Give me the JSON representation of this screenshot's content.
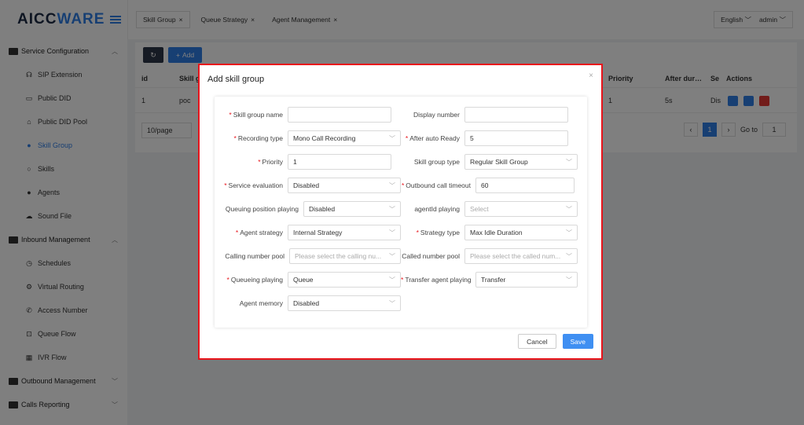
{
  "app": {
    "logo_main": "AICC",
    "logo_accent": "WARE"
  },
  "colors": {
    "accent": "#2f7ee6",
    "danger": "#e8141b",
    "search": "#2f7ee6",
    "edit": "#2f7ee6",
    "delete": "#e53935"
  },
  "sidebar": {
    "groups": [
      {
        "label": "Service Configuration",
        "icon": "id-card-icon",
        "items": [
          {
            "label": "SIP Extension",
            "icon": "headset-icon"
          },
          {
            "label": "Public DID",
            "icon": "folder-icon"
          },
          {
            "label": "Public DID Pool",
            "icon": "home-icon"
          },
          {
            "label": "Skill Group",
            "icon": "user-icon"
          },
          {
            "label": "Skills",
            "icon": "user-outline-icon"
          },
          {
            "label": "Agents",
            "icon": "user-icon"
          },
          {
            "label": "Sound File",
            "icon": "cloud-icon"
          }
        ]
      },
      {
        "label": "Inbound Management",
        "icon": "list-icon",
        "items": [
          {
            "label": "Schedules",
            "icon": "clock-icon"
          },
          {
            "label": "Virtual Routing",
            "icon": "gear-icon"
          },
          {
            "label": "Access Number",
            "icon": "phone-icon"
          },
          {
            "label": "Queue Flow",
            "icon": "inbox-icon"
          },
          {
            "label": "IVR Flow",
            "icon": "grid-icon"
          }
        ]
      },
      {
        "label": "Outbound Management",
        "icon": "list-icon"
      },
      {
        "label": "Calls Reporting",
        "icon": "bar-chart-icon"
      }
    ]
  },
  "topbar": {
    "tabs": [
      "Skill Group",
      "Queue Strategy",
      "Agent Management"
    ],
    "close_glyph": "×",
    "language": "English",
    "user": "admin"
  },
  "content": {
    "add_label": "Add",
    "columns": [
      "id",
      "Skill g",
      "Priority",
      "After dur…",
      "Se",
      "Actions"
    ],
    "row": {
      "id": "1",
      "name": "poc",
      "priority": "1",
      "after": "5s",
      "service": "Dis"
    },
    "page_size": "10/page",
    "current_page": "1",
    "goto_label": "Go to",
    "goto_value": "1"
  },
  "modal": {
    "title": "Add skill group",
    "close": "×",
    "fields": {
      "skill_group_name": {
        "label": "Skill group name",
        "value": ""
      },
      "display_number": {
        "label": "Display number",
        "value": ""
      },
      "recording_type": {
        "label": "Recording type",
        "value": "Mono Call Recording"
      },
      "after_auto_ready": {
        "label": "After auto Ready",
        "value": "5"
      },
      "priority": {
        "label": "Priority",
        "value": "1"
      },
      "skill_group_type": {
        "label": "Skill group type",
        "value": "Regular Skill Group"
      },
      "service_evaluation": {
        "label": "Service evaluation",
        "value": "Disabled"
      },
      "outbound_call_timeout": {
        "label": "Outbound call timeout",
        "value": "60"
      },
      "queuing_position_playing": {
        "label": "Queuing position playing",
        "value": "Disabled"
      },
      "agentid_playing": {
        "label": "agentId playing",
        "placeholder": "Select"
      },
      "agent_strategy": {
        "label": "Agent strategy",
        "value": "Internal Strategy"
      },
      "strategy_type": {
        "label": "Strategy type",
        "value": "Max Idle Duration"
      },
      "calling_number_pool": {
        "label": "Calling number pool",
        "placeholder": "Please select the calling nu..."
      },
      "called_number_pool": {
        "label": "Called number pool",
        "placeholder": "Please select the called num..."
      },
      "queueing_playing": {
        "label": "Queueing playing",
        "value": "Queue"
      },
      "transfer_agent_playing": {
        "label": "Transfer agent playing",
        "value": "Transfer"
      },
      "agent_memory": {
        "label": "Agent memory",
        "value": "Disabled"
      }
    },
    "cancel_label": "Cancel",
    "save_label": "Save"
  }
}
